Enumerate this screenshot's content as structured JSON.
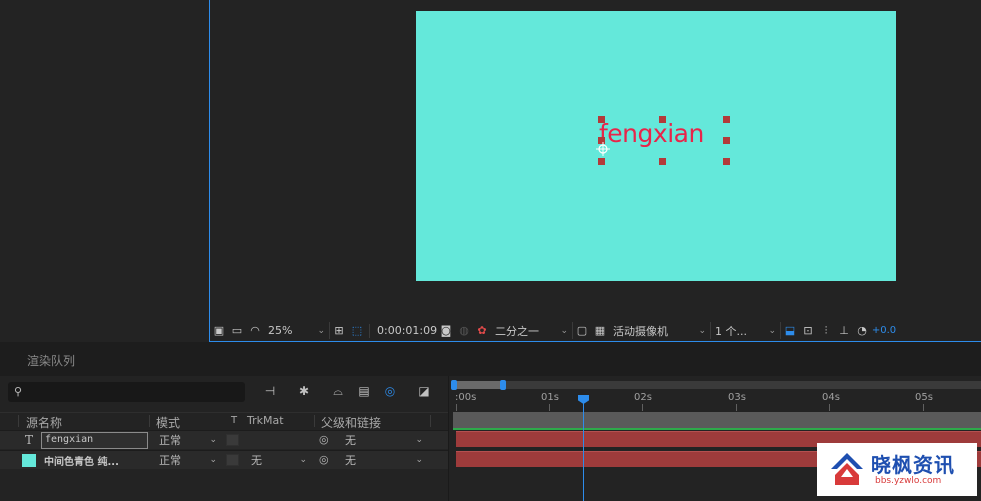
{
  "composition": {
    "text_layer": "fengxian",
    "bg_color": "#64e8da",
    "text_color": "#e8254a"
  },
  "viewer_toolbar": {
    "zoom": "25%",
    "timecode": "0:00:01:09",
    "resolution": "二分之一",
    "camera": "活动摄像机",
    "views": "1 个...",
    "exposure": "+0.0"
  },
  "render_queue": {
    "tab_label": "渲染队列"
  },
  "timeline": {
    "columns": {
      "source_name": "源名称",
      "mode": "模式",
      "t": "T",
      "trkmat": "TrkMat",
      "parent": "父级和链接"
    },
    "layers": [
      {
        "type_icon": "T",
        "name": "fengxian",
        "mode": "正常",
        "trkmat": "",
        "parent": "无",
        "color": "#9e3b3b"
      },
      {
        "type_icon": "solid",
        "name": "中间色青色 纯...",
        "mode": "正常",
        "trkmat": "无",
        "parent": "无",
        "color": "#64e8da"
      }
    ],
    "ruler": {
      "labels": [
        ":00s",
        "01s",
        "02s",
        "03s",
        "04s",
        "05s"
      ],
      "playhead_time": "0:00:01:09"
    }
  },
  "watermark": {
    "title": "晓枫资讯",
    "url": "bbs.yzwlo.com"
  },
  "accent_color": "#2d8ceb"
}
